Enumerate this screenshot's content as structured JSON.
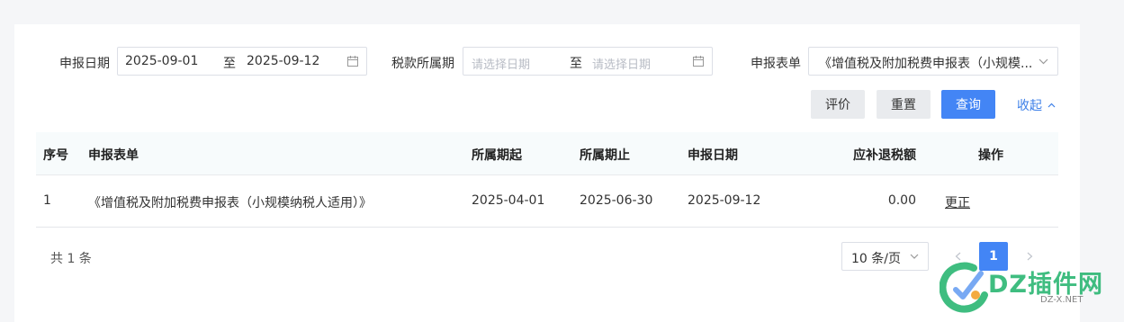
{
  "filters": {
    "declare_date": {
      "label": "申报日期",
      "start": "2025-09-01",
      "sep": "至",
      "end": "2025-09-12"
    },
    "tax_period": {
      "label": "税款所属期",
      "start_placeholder": "请选择日期",
      "sep": "至",
      "end_placeholder": "请选择日期"
    },
    "form": {
      "label": "申报表单",
      "value": "《增值税及附加税费申报表（小规模..."
    }
  },
  "actions": {
    "evaluate": "评价",
    "reset": "重置",
    "query": "查询",
    "collapse": "收起"
  },
  "table": {
    "headers": [
      "序号",
      "申报表单",
      "所属期起",
      "所属期止",
      "申报日期",
      "应补退税额",
      "操作"
    ],
    "rows": [
      {
        "index": "1",
        "form": "《增值税及附加税费申报表（小规模纳税人适用）》",
        "period_start": "2025-04-01",
        "period_end": "2025-06-30",
        "declare_date": "2025-09-12",
        "amount": "0.00",
        "action": "更正"
      }
    ]
  },
  "pagination": {
    "total": "共 1 条",
    "page_size": "10 条/页",
    "current_page": "1"
  },
  "watermark": {
    "text": "DZ插件网",
    "sub": "DZ-X.NET"
  },
  "colors": {
    "primary": "#4385f5",
    "link": "#3c7fe8",
    "watermark_green": "#2bb673"
  }
}
